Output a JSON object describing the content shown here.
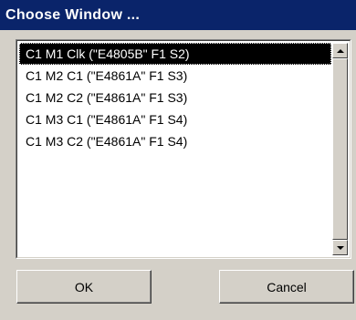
{
  "window": {
    "title": "Choose Window ..."
  },
  "list": {
    "items": [
      "C1 M1 Clk (\"E4805B\" F1 S2)",
      "C1 M2 C1 (\"E4861A\" F1 S3)",
      "C1 M2 C2 (\"E4861A\" F1 S3)",
      "C1 M3 C1 (\"E4861A\" F1 S4)",
      "C1 M3 C2 (\"E4861A\" F1 S4)"
    ],
    "selected_index": 0
  },
  "buttons": {
    "ok_label": "OK",
    "cancel_label": "Cancel"
  },
  "colors": {
    "titlebar": "#0a246a",
    "face": "#d4d0c8",
    "selection": "#000000"
  },
  "icons": {
    "scroll_up": "triangle-up",
    "scroll_down": "triangle-down"
  }
}
